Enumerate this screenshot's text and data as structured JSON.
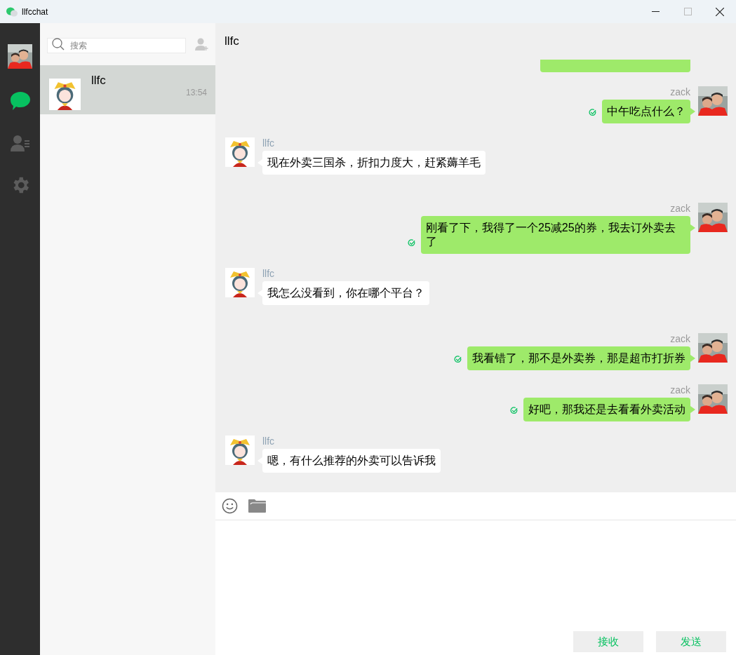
{
  "window": {
    "title": "llfcchat"
  },
  "nav": [
    {
      "kind": "chat",
      "selected": true
    },
    {
      "kind": "contacts",
      "selected": false
    },
    {
      "kind": "settings",
      "selected": false
    }
  ],
  "search": {
    "placeholder": "搜索"
  },
  "chats": [
    {
      "name": "llfc",
      "time": "13:54",
      "selected": true
    }
  ],
  "conversation": {
    "title": "llfc",
    "messages": [
      {
        "kind": "cut"
      },
      {
        "kind": "self",
        "name": "zack",
        "text": "中午吃点什么？",
        "sent": true
      },
      {
        "kind": "other",
        "name": "llfc",
        "text": "现在外卖三国杀，折扣力度大，赶紧薅羊毛"
      },
      {
        "kind": "self",
        "name": "zack",
        "text": "刚看了下，我得了一个25减25的券，我去订外卖去了",
        "sent": true
      },
      {
        "kind": "other",
        "name": "llfc",
        "text": "我怎么没看到，你在哪个平台？"
      },
      {
        "kind": "self",
        "name": "zack",
        "text": "我看错了，那不是外卖券，那是超市打折券",
        "sent": true
      },
      {
        "kind": "self",
        "name": "zack",
        "text": "好吧，那我还是去看看外卖活动",
        "sent": true
      },
      {
        "kind": "other",
        "name": "llfc",
        "text": "嗯，有什么推荐的外卖可以告诉我"
      }
    ]
  },
  "buttons": [
    "接收",
    "发送"
  ]
}
